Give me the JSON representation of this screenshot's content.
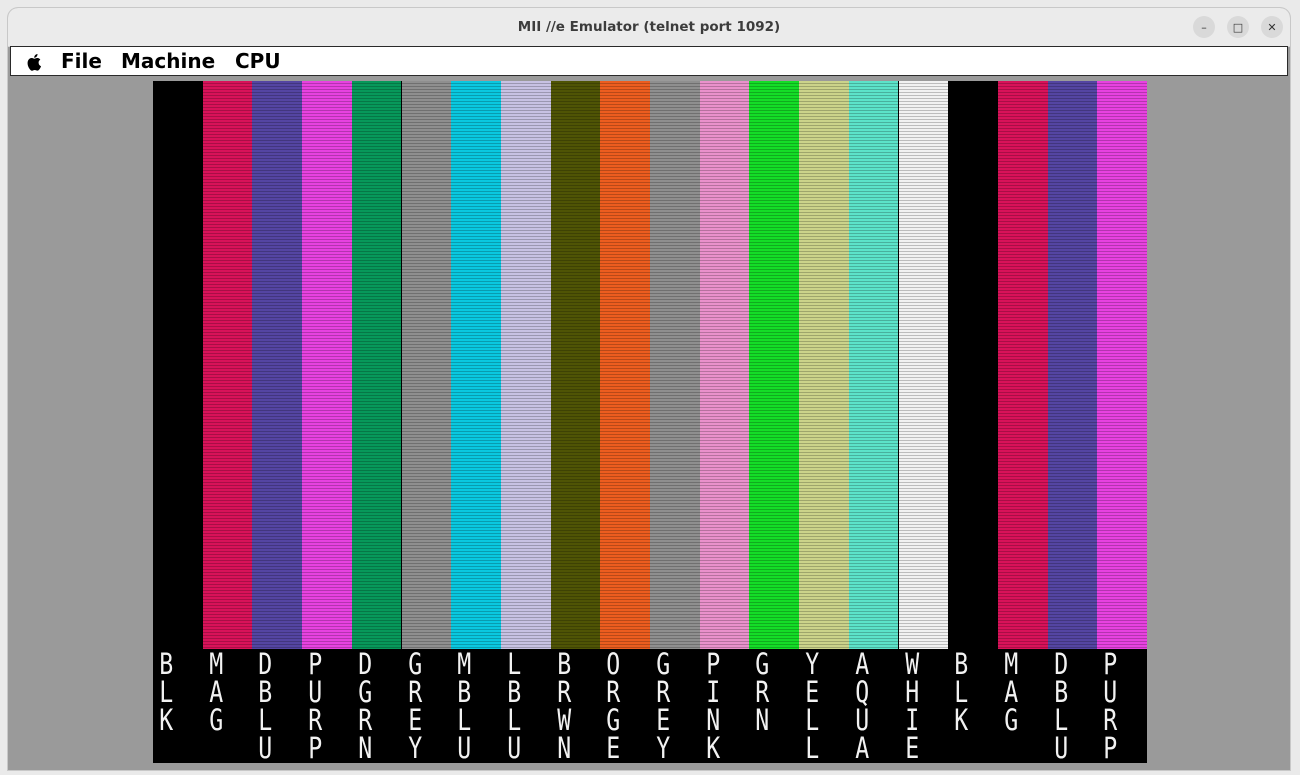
{
  "window": {
    "title": "MII //e Emulator (telnet port 1092)"
  },
  "window_controls": {
    "minimize": "–",
    "maximize": "□",
    "close": "✕"
  },
  "menubar": {
    "apple_icon": "apple-icon",
    "items": [
      {
        "label": "File"
      },
      {
        "label": "Machine"
      },
      {
        "label": "CPU"
      }
    ]
  },
  "screen": {
    "bars": [
      {
        "label": "BLK",
        "color": "#000000"
      },
      {
        "label": "MAG",
        "color": "#d81259"
      },
      {
        "label": "DBLU",
        "color": "#5445a2"
      },
      {
        "label": "PURP",
        "color": "#e742e0"
      },
      {
        "label": "DGRN",
        "color": "#07985a"
      },
      {
        "label": "GREY",
        "color": "#8f8f8f"
      },
      {
        "label": "MBLU",
        "color": "#0ac8e0"
      },
      {
        "label": "LBLU",
        "color": "#c7c1e3"
      },
      {
        "label": "BRWN",
        "color": "#4f5405"
      },
      {
        "label": "ORGE",
        "color": "#ec5d1f"
      },
      {
        "label": "GREY",
        "color": "#8f8f8f"
      },
      {
        "label": "PINK",
        "color": "#e991cb"
      },
      {
        "label": "GRN",
        "color": "#14dd27"
      },
      {
        "label": "YELL",
        "color": "#cbd38a"
      },
      {
        "label": "AQUA",
        "color": "#5ce3c9"
      },
      {
        "label": "WHIE",
        "color": "#f1f1f1"
      },
      {
        "label": "BLK",
        "color": "#000000"
      },
      {
        "label": "MAG",
        "color": "#d81259"
      },
      {
        "label": "DBLU",
        "color": "#5445a2"
      },
      {
        "label": "PURP",
        "color": "#e742e0"
      }
    ]
  }
}
